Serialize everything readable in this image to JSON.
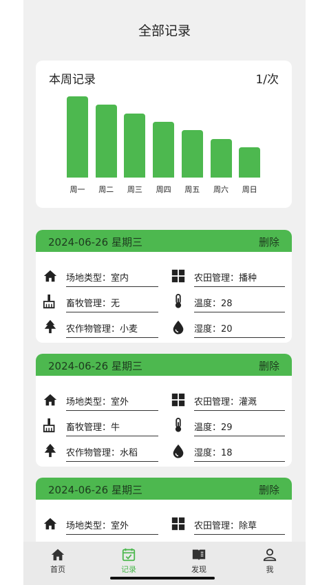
{
  "header": {
    "title": "全部记录"
  },
  "week_summary": {
    "title": "本周记录",
    "count_label": "1/次",
    "chart_data": {
      "type": "bar",
      "categories": [
        "周一",
        "周二",
        "周三",
        "周四",
        "周五",
        "周六",
        "周日"
      ],
      "values": [
        7,
        6.3,
        5.5,
        4.8,
        4.1,
        3.3,
        2.6
      ],
      "color": "#4db84f"
    }
  },
  "records": [
    {
      "date": "2024-06-26 星期三",
      "delete_label": "删除",
      "site_type": "场地类型：室内",
      "field_mgmt": "农田管理：播种",
      "livestock": "畜牧管理：无",
      "temperature": "温度：28",
      "crop": "农作物管理：小麦",
      "humidity": "湿度：20"
    },
    {
      "date": "2024-06-26 星期三",
      "delete_label": "删除",
      "site_type": "场地类型：室外",
      "field_mgmt": "农田管理：灌溉",
      "livestock": "畜牧管理：牛",
      "temperature": "温度：29",
      "crop": "农作物管理：水稻",
      "humidity": "湿度：18"
    },
    {
      "date": "2024-06-26 星期三",
      "delete_label": "删除",
      "site_type": "场地类型：室外",
      "field_mgmt": "农田管理：除草"
    }
  ],
  "tabs": [
    {
      "label": "首页",
      "icon": "home-icon"
    },
    {
      "label": "记录",
      "icon": "calendar-check-icon",
      "active": true
    },
    {
      "label": "发现",
      "icon": "book-icon"
    },
    {
      "label": "我",
      "icon": "user-icon"
    }
  ],
  "colors": {
    "accent": "#4db84f",
    "background": "#f0f0f0"
  }
}
